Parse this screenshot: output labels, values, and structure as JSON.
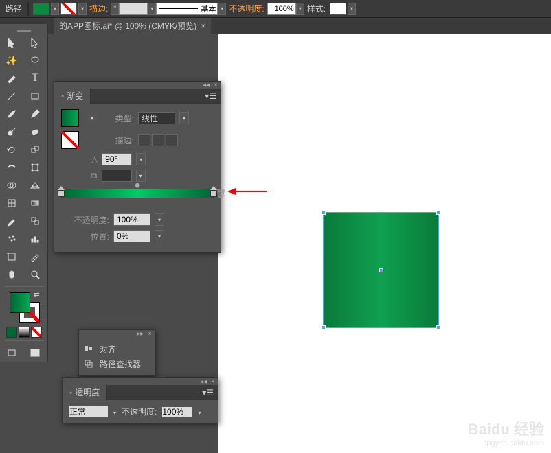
{
  "topbar": {
    "path_label": "路径",
    "fill_color": "#0a8a3f",
    "stroke_label": "描边:",
    "stroke_width": "",
    "stroke_style_label": "基本",
    "opacity_label": "不透明度:",
    "opacity_value": "100%",
    "style_label": "样式:"
  },
  "tab": {
    "title": "的APP图标.ai* @ 100% (CMYK/预览)",
    "close": "×"
  },
  "gradient_panel": {
    "title": "渐变",
    "type_label": "类型:",
    "type_value": "线性",
    "stroke_label": "描边:",
    "angle_value": "90°",
    "opacity_label": "不透明度:",
    "opacity_value": "100%",
    "position_label": "位置:",
    "position_value": "0%",
    "stops": [
      {
        "position": 0,
        "color": "#006633"
      },
      {
        "position": 100,
        "color": "#006633"
      }
    ]
  },
  "mini_panel": {
    "items": [
      {
        "icon": "align",
        "label": "对齐"
      },
      {
        "icon": "pathfinder",
        "label": "路径查找器"
      }
    ]
  },
  "transparency_panel": {
    "title": "透明度",
    "mode_value": "正常",
    "opacity_label": "不透明度:",
    "opacity_value": "100%"
  },
  "canvas": {
    "rect_fill_start": "#0a7a3a",
    "rect_fill_end": "#0fa050"
  },
  "watermark": {
    "brand": "Baidu",
    "suffix": "经验",
    "url": "jingyan.baidu.com"
  },
  "icons": {
    "collapse": "◂◂",
    "close": "×",
    "menu": "▾",
    "trash": "🗑",
    "angle": "△",
    "ratio": "⧉"
  }
}
